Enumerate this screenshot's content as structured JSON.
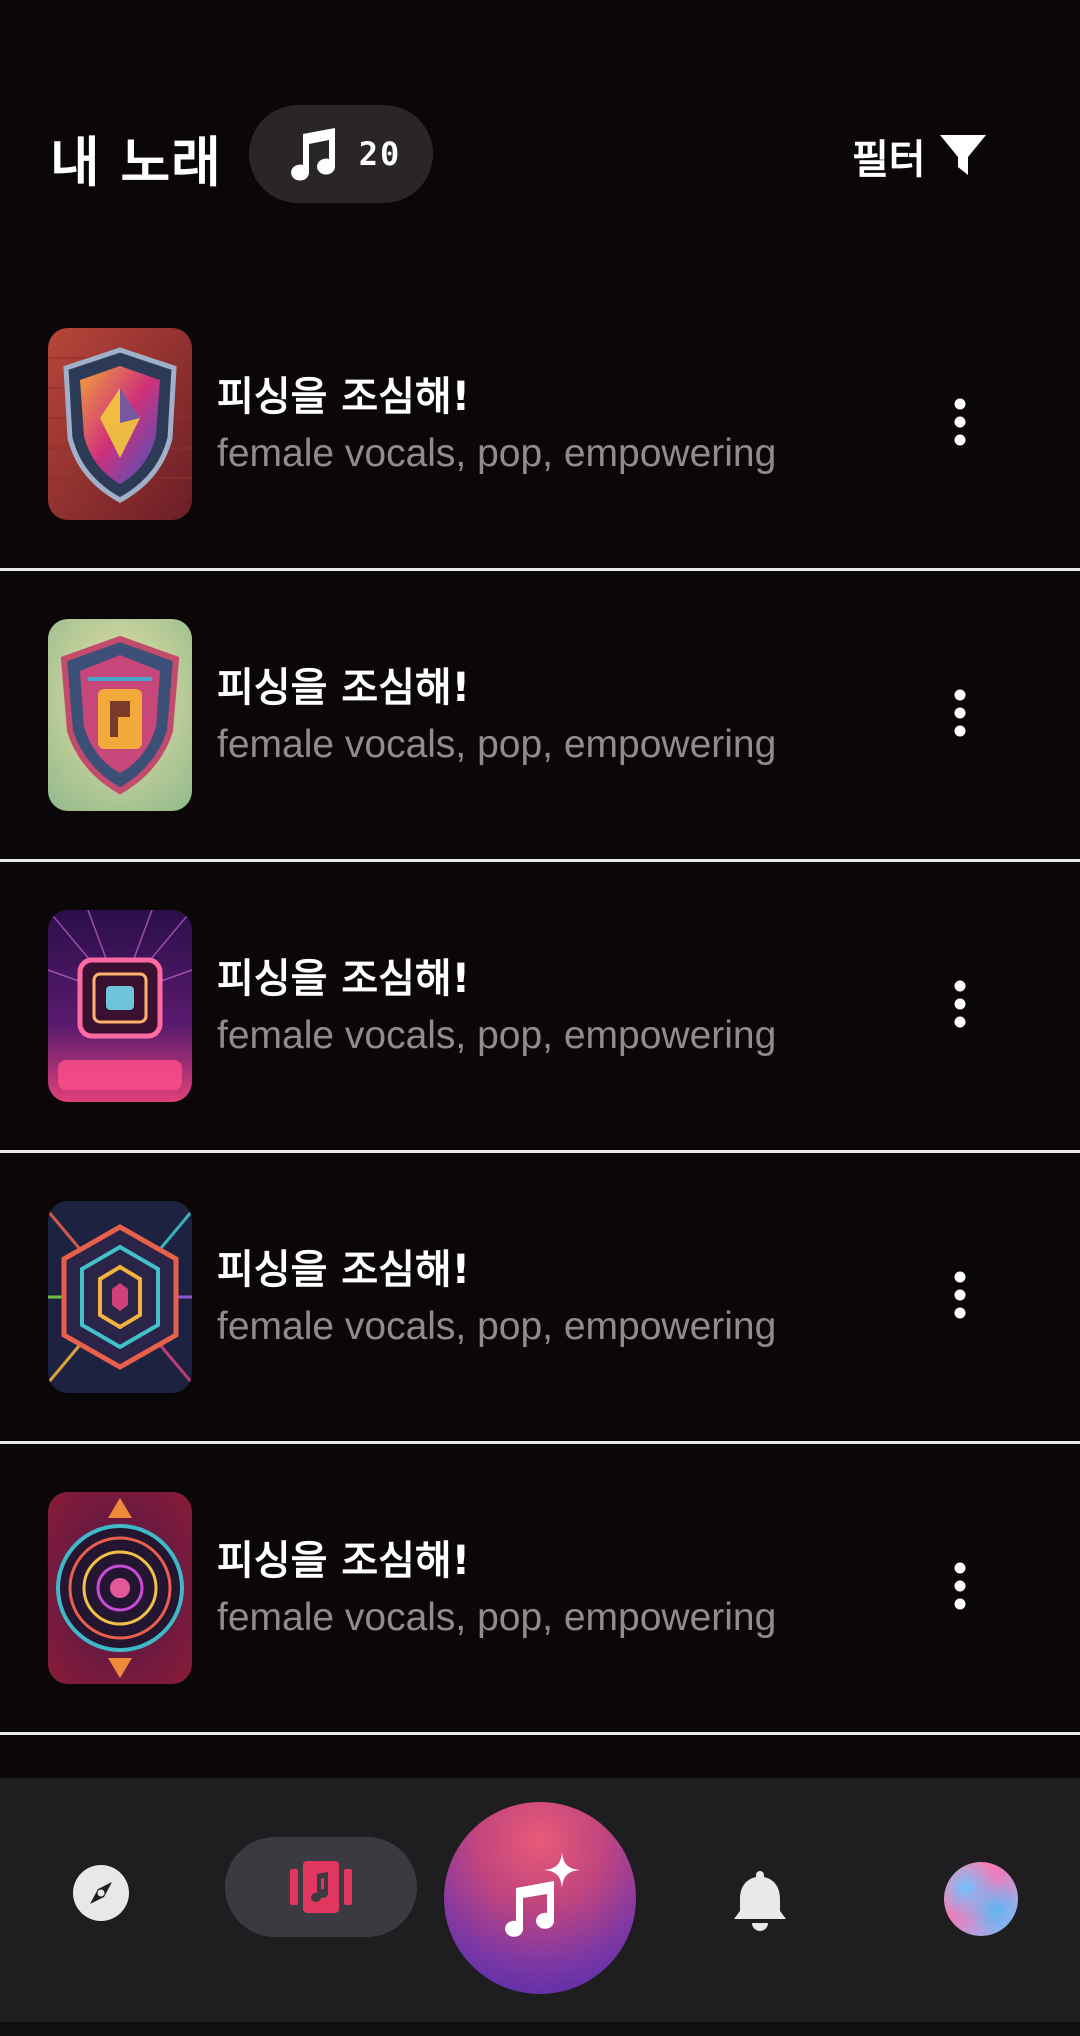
{
  "header": {
    "title": "내 노래",
    "song_count": "20",
    "filter_label": "필터"
  },
  "songs": [
    {
      "title": "피싱을 조심해!",
      "tags": "female vocals, pop, empowering",
      "cover_icon": "shield-cover-art"
    },
    {
      "title": "피싱을 조심해!",
      "tags": "female vocals, pop, empowering",
      "cover_icon": "shield-cover-art"
    },
    {
      "title": "피싱을 조심해!",
      "tags": "female vocals, pop, empowering",
      "cover_icon": "neon-frame-cover-art"
    },
    {
      "title": "피싱을 조심해!",
      "tags": "female vocals, pop, empowering",
      "cover_icon": "hexagon-cover-art"
    },
    {
      "title": "피싱을 조심해!",
      "tags": "female vocals, pop, empowering",
      "cover_icon": "circle-cover-art"
    }
  ],
  "bottom_nav": {
    "items": [
      {
        "icon": "compass-icon",
        "active": false
      },
      {
        "icon": "music-library-icon",
        "active": true
      },
      {
        "icon": "create-music-sparkle-icon",
        "active": false
      },
      {
        "icon": "bell-icon",
        "active": false
      },
      {
        "icon": "avatar",
        "active": false
      }
    ]
  },
  "colors": {
    "background": "#0b0708",
    "divider": "#e8e8e8",
    "subtitle": "#8f8c8d",
    "nav_background": "#1e1e21",
    "accent": "#e0365f"
  }
}
